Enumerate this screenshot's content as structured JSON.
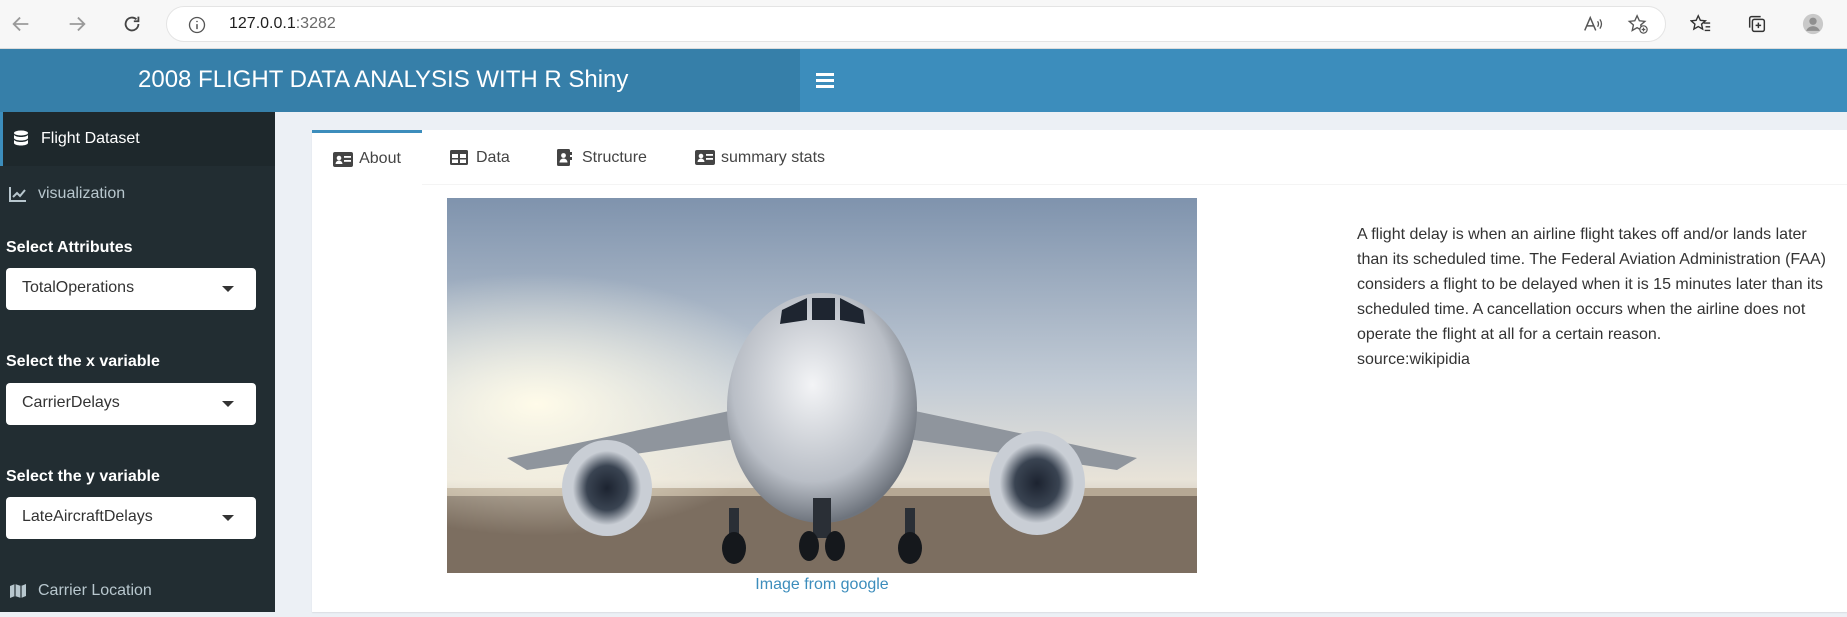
{
  "browser": {
    "url_host": "127.0.0.1",
    "url_port": ":3282"
  },
  "header": {
    "title": "2008 FLIGHT DATA ANALYSIS WITH R Shiny"
  },
  "sidebar": {
    "items": [
      {
        "label": "Flight Dataset",
        "icon": "database-icon"
      },
      {
        "label": "visualization",
        "icon": "line-chart-icon"
      },
      {
        "label": "Carrier Location",
        "icon": "map-icon"
      }
    ],
    "controls": [
      {
        "label": "Select Attributes",
        "value": "TotalOperations"
      },
      {
        "label": "Select the x variable",
        "value": "CarrierDelays"
      },
      {
        "label": "Select the y variable",
        "value": "LateAircraftDelays"
      }
    ]
  },
  "tabs": [
    {
      "label": "About",
      "icon": "id-card-icon",
      "active": true
    },
    {
      "label": "Data",
      "icon": "table-icon",
      "active": false
    },
    {
      "label": "Structure",
      "icon": "contact-book-icon",
      "active": false
    },
    {
      "label": "summary stats",
      "icon": "id-card-icon",
      "active": false
    }
  ],
  "about": {
    "image_caption": "Image from google",
    "description": "A flight delay is when an airline flight takes off and/or lands later than its scheduled time. The Federal Aviation Administration (FAA) considers a flight to be delayed when it is 15 minutes later than its scheduled time. A cancellation occurs when the airline does not operate the flight at all for a certain reason.",
    "source": "source:wikipidia"
  },
  "colors": {
    "header_logo": "#367fa9",
    "header_navbar": "#3c8dbc",
    "sidebar_bg": "#222d32",
    "sidebar_active": "#1e282c",
    "content_bg": "#ecf0f5",
    "link": "#3c8dbc"
  }
}
